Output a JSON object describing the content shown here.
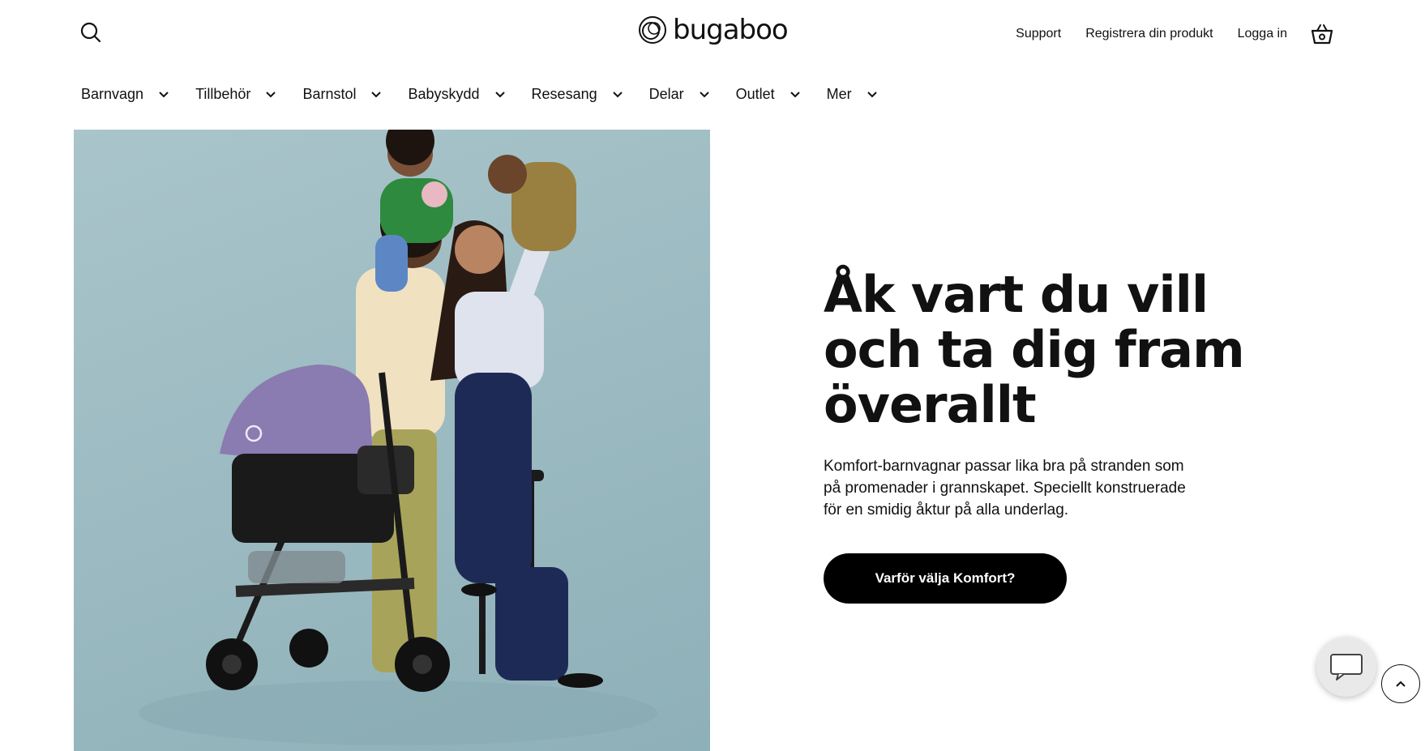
{
  "header": {
    "brand": "bugaboo",
    "links": {
      "support": "Support",
      "register": "Registrera din produkt",
      "login": "Logga in"
    }
  },
  "nav": {
    "items": [
      {
        "label": "Barnvagn"
      },
      {
        "label": "Tillbehör"
      },
      {
        "label": "Barnstol"
      },
      {
        "label": "Babyskydd"
      },
      {
        "label": "Resesang"
      },
      {
        "label": "Delar"
      },
      {
        "label": "Outlet"
      },
      {
        "label": "Mer"
      }
    ]
  },
  "hero": {
    "headline_line1": "Åk vart du vill",
    "headline_line2": "och ta dig fram",
    "headline_line3": "överallt",
    "description": "Komfort-barnvagnar passar lika bra på stranden som på promenader i grannskapet. Speciellt konstruerade för en smidig åktur på alla underlag.",
    "cta_label": "Varför välja Komfort?"
  },
  "colors": {
    "accent": "#000000",
    "hero_bg": "#9dbbc2",
    "canopy": "#8a7bb0"
  },
  "icons": [
    "search-icon",
    "cart-icon",
    "chevron-down-icon",
    "chat-icon",
    "arrow-up-icon"
  ]
}
